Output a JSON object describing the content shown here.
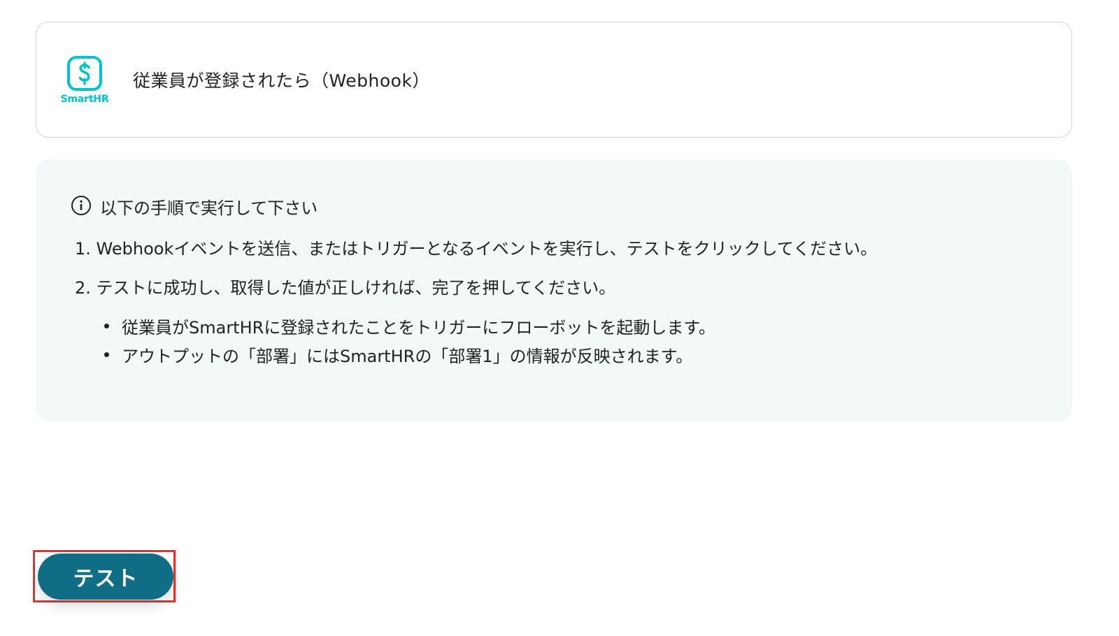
{
  "trigger": {
    "app_name": "SmartHR",
    "title": "従業員が登録されたら（Webhook）",
    "logo_color": "#00c4cc"
  },
  "instructions": {
    "heading": "以下の手順で実行して下さい",
    "steps": [
      "1. Webhookイベントを送信、またはトリガーとなるイベントを実行し、テストをクリックしてください。",
      "2. テストに成功し、取得した値が正しければ、完了を押してください。"
    ],
    "notes": [
      "従業員がSmartHRに登録されたことをトリガーにフローボットを起動します。",
      "アウトプットの「部署」にはSmartHRの「部署1」の情報が反映されます。"
    ],
    "icon": "info-icon",
    "panel_color": "#f3f8f8"
  },
  "actions": {
    "test_label": "テスト",
    "button_color": "#0f6d86",
    "highlight_color": "#e6332a"
  }
}
